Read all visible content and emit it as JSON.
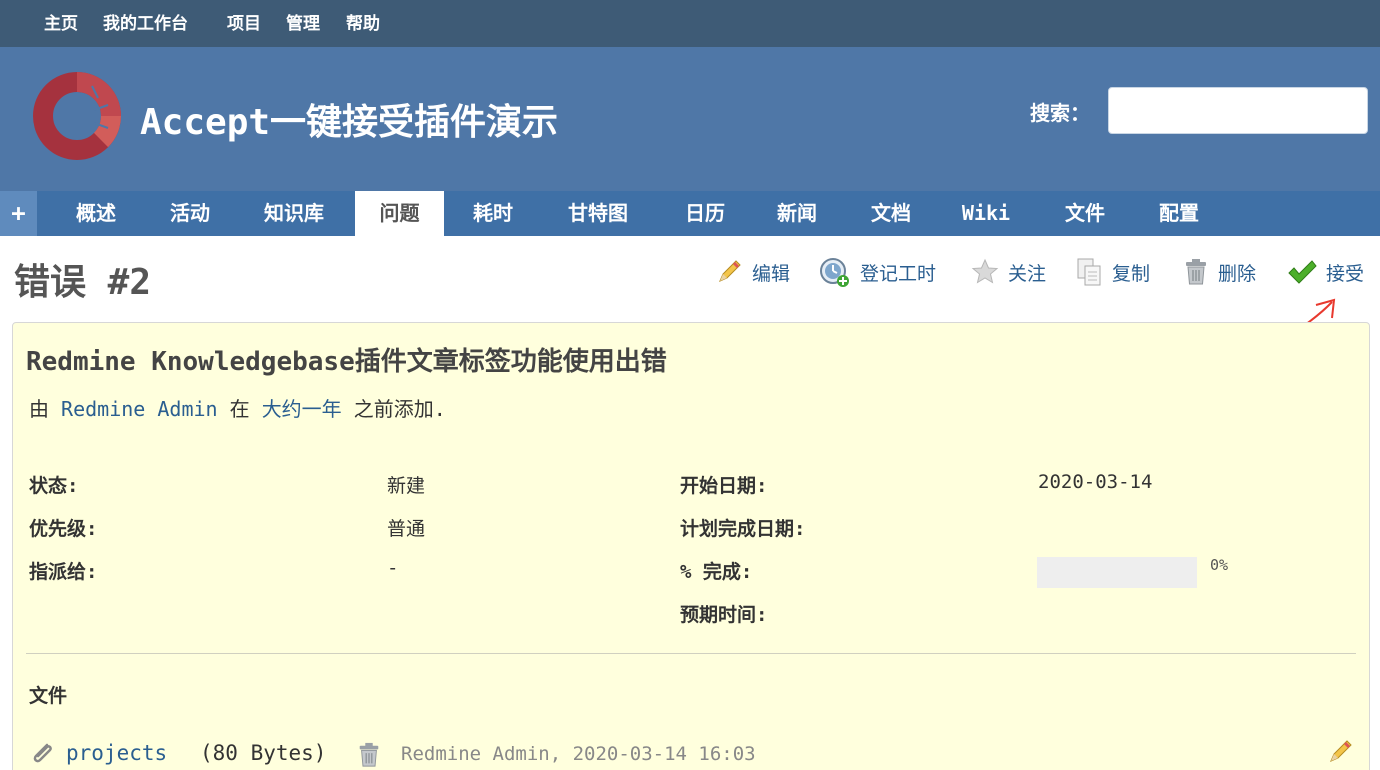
{
  "top_menu": {
    "items": [
      "主页",
      "我的工作台",
      "项目",
      "管理",
      "帮助"
    ]
  },
  "header": {
    "project_title": "Accept一键接受插件演示",
    "search_label": "搜索：",
    "search_value": ""
  },
  "main_menu": {
    "new_label": "+",
    "items": [
      "概述",
      "活动",
      "知识库",
      "问题",
      "耗时",
      "甘特图",
      "日历",
      "新闻",
      "文档",
      "Wiki",
      "文件",
      "配置"
    ],
    "selected": "问题"
  },
  "issue": {
    "heading": "错误 #2",
    "actions": [
      "编辑",
      "登记工时",
      "关注",
      "复制",
      "删除",
      "接受"
    ],
    "subject": "Redmine Knowledgebase插件文章标签功能使用出错",
    "author_prefix": "由",
    "author": "Redmine Admin",
    "author_middle": "在",
    "time_ago": "大约一年",
    "author_suffix": "之前添加.",
    "attributes": {
      "status_label": "状态:",
      "status_value": "新建",
      "priority_label": "优先级:",
      "priority_value": "普通",
      "assignee_label": "指派给:",
      "assignee_value": "-",
      "start_date_label": "开始日期:",
      "start_date_value": "2020-03-14",
      "due_date_label": "计划完成日期:",
      "due_date_value": "",
      "done_ratio_label": "% 完成:",
      "done_ratio_value": "0%",
      "done_ratio_fraction": 0,
      "estimated_label": "预期时间:",
      "estimated_value": ""
    },
    "files_heading": "文件",
    "attachment": {
      "name": "projects",
      "size": "(80 Bytes)",
      "meta": "Redmine Admin, 2020-03-14 16:03"
    }
  },
  "colors": {
    "top_menu_bg": "#3e5b76",
    "header_bg": "#4f77a7",
    "main_menu_bg": "#3f70a6",
    "link": "#2a5e90",
    "issue_bg": "#ffffdd",
    "logo_red": "#a5323e",
    "annotation_red": "#e8392e",
    "accept_green": "#4caf2a"
  }
}
